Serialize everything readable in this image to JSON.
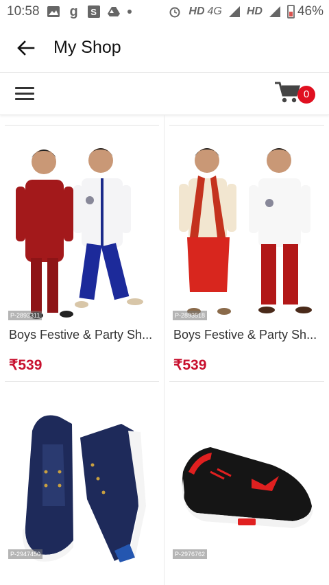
{
  "status_bar": {
    "time": "10:58",
    "network_hd1": "HD",
    "network_type": "4G",
    "network_hd2": "HD",
    "battery": "46%"
  },
  "header": {
    "title": "My Shop"
  },
  "toolbar": {
    "cart_count": "0"
  },
  "products": [
    {
      "sku": "P-2893311",
      "name": "Boys Festive & Party Sh...",
      "price": "₹539"
    },
    {
      "sku": "P-2893518",
      "name": "Boys Festive & Party Sh...",
      "price": "₹539"
    },
    {
      "sku": "P-2947450",
      "name": "",
      "price": ""
    },
    {
      "sku": "P-2976762",
      "name": "",
      "price": ""
    }
  ],
  "colors": {
    "accent": "#c8102e",
    "badge": "#e01020"
  }
}
